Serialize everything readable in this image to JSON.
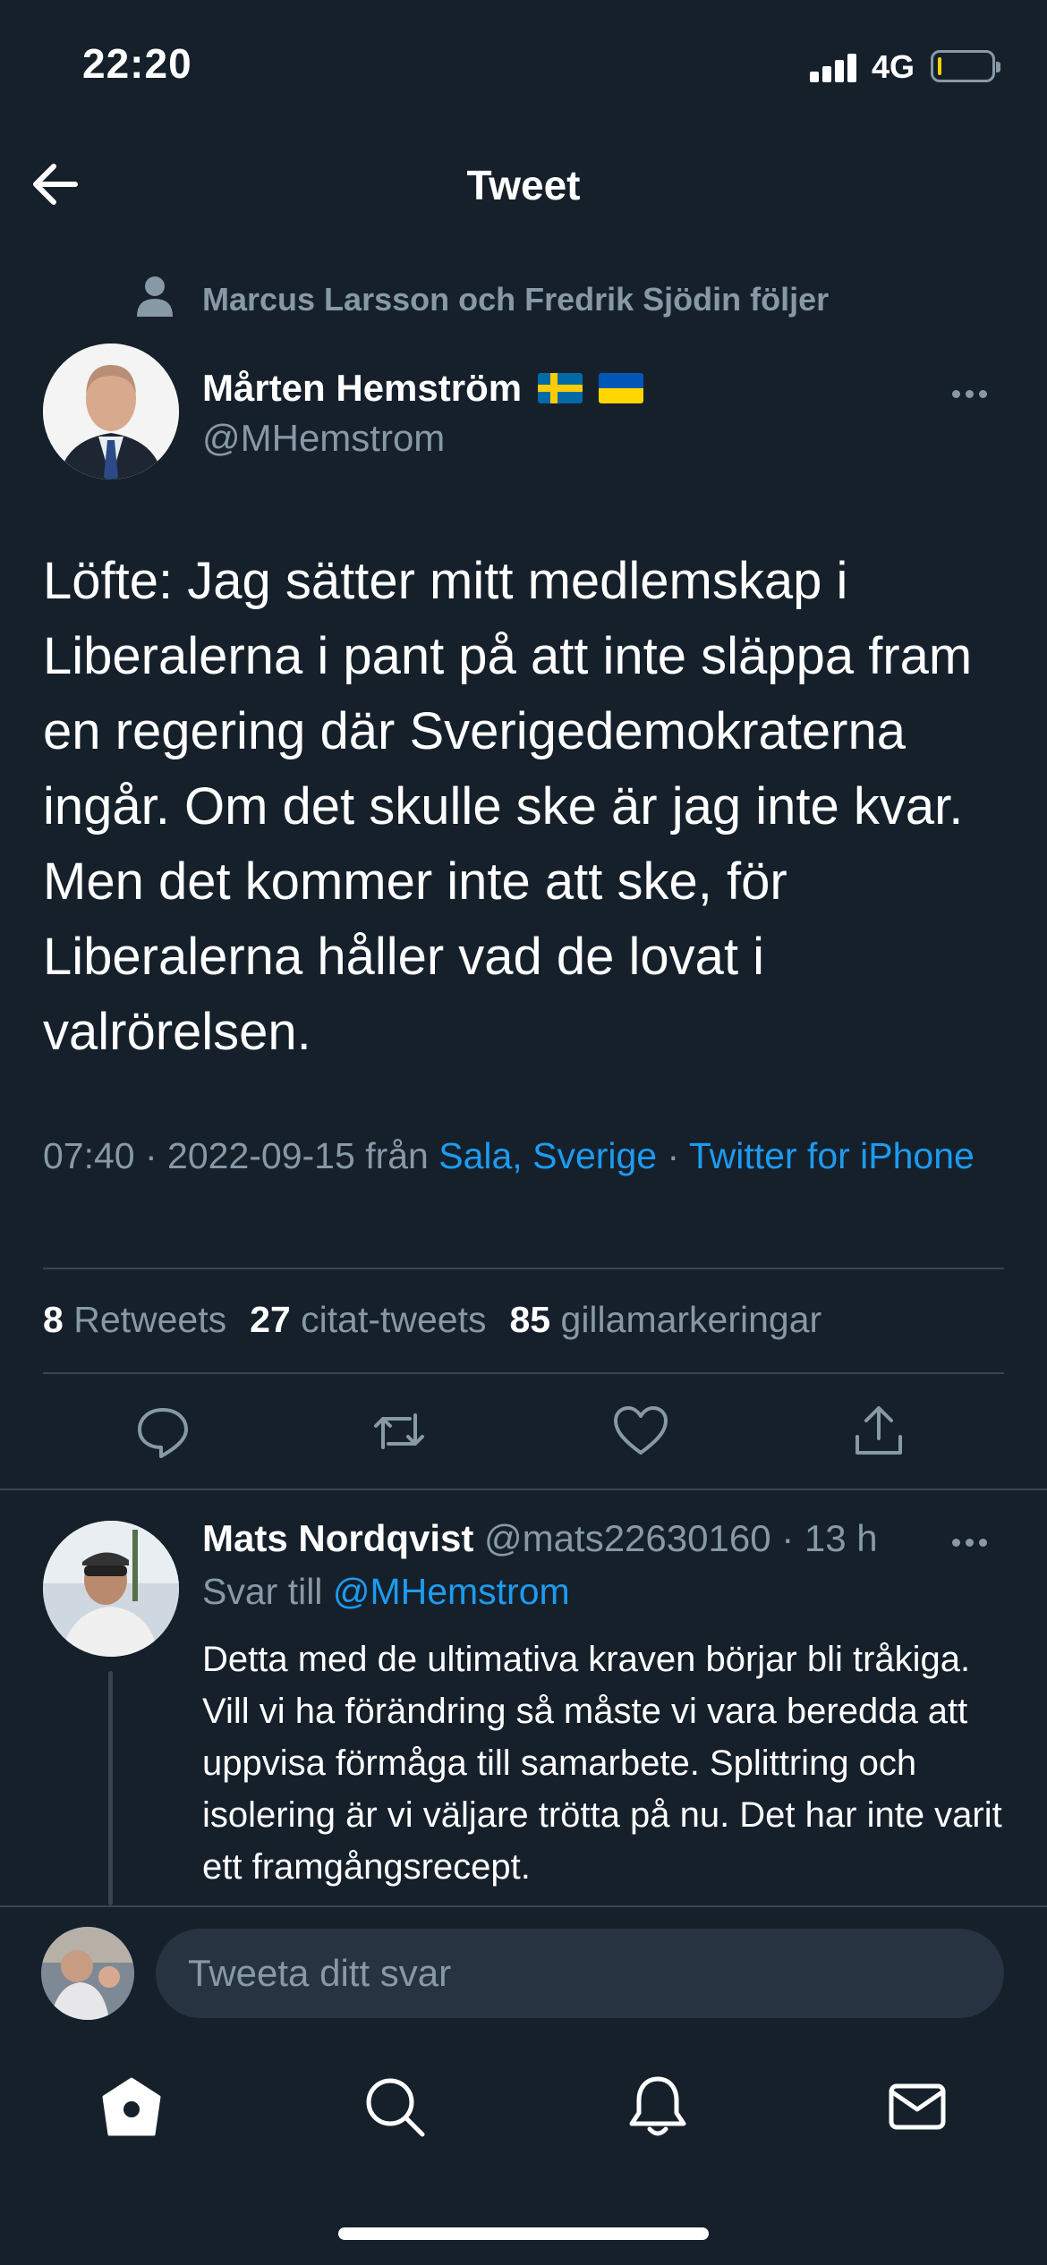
{
  "status_bar": {
    "time": "22:20",
    "network": "4G",
    "battery_level": 0.08
  },
  "header": {
    "title": "Tweet"
  },
  "social_context": "Marcus Larsson och Fredrik Sjödin följer",
  "author": {
    "name": "Mårten Hemström",
    "handle": "@MHemstrom",
    "flags": [
      "Sweden flag",
      "Ukraine flag"
    ]
  },
  "tweet": {
    "text": "Löfte: Jag sätter mitt medlemskap i Liberalerna i pant på att inte släppa fram en regering där Sverigedemokraterna ingår. Om det skulle ske är jag inte kvar. Men det kommer inte att ske, för Liberalerna håller vad de lovat i valrörelsen.",
    "time": "07:40",
    "date": "2022-09-15",
    "from_label": "från",
    "location": "Sala, Sverige",
    "client": "Twitter for iPhone"
  },
  "stats": {
    "retweets": {
      "count": "8",
      "label": "Retweets"
    },
    "quotes": {
      "count": "27",
      "label": "citat-tweets"
    },
    "likes": {
      "count": "85",
      "label": "gillamarkeringar"
    }
  },
  "reply": {
    "name": "Mats Nordqvist",
    "handle": "@mats22630160",
    "time": "13 h",
    "reply_to_label": "Svar till",
    "reply_to_handle": "@MHemstrom",
    "text": "Detta med de ultimativa kraven börjar bli tråkiga. Vill vi ha förändring så måste vi vara beredda att uppvisa förmåga till samarbete. Splittring och isolering är vi väljare trötta på nu. Det har inte varit ett framgångsrecept."
  },
  "compose": {
    "placeholder": "Tweeta ditt svar"
  },
  "tabs": [
    "home-icon",
    "search-icon",
    "notifications-icon",
    "messages-icon"
  ],
  "colors": {
    "background": "#15202b",
    "accent": "#1d9bf0",
    "muted": "#8899a6",
    "divider": "#38444d"
  }
}
